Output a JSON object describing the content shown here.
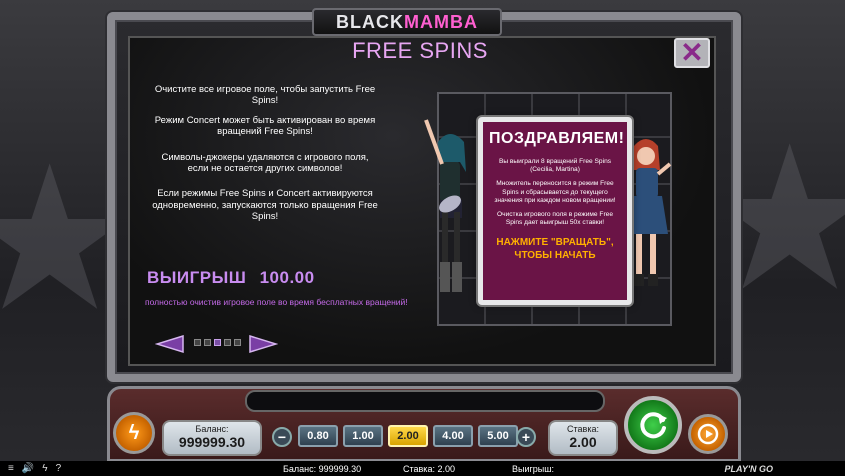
{
  "logo": {
    "prefix": "BLACK",
    "accent": "MAMBA"
  },
  "panel": {
    "title": "FREE SPINS",
    "rules": [
      "Очистите все игровое поле, чтобы запустить Free Spins!",
      "Режим Concert может быть активирован во время вращений Free Spins!",
      "Символы-джокеры удаляются с игрового поля, если не остается других символов!",
      "Если режимы Free Spins и Concert активируются одновременно, запускаются только вращения Free Spins!"
    ],
    "win_label": "ВЫИГРЫШ",
    "win_value": "100.00",
    "win_note": "полностью очистив игровое поле во время бесплатных вращений!",
    "page_count": 5,
    "active_page": 3
  },
  "popup": {
    "heading": "ПОЗДРАВЛЯЕМ!",
    "line1": "Вы выиграли 8 вращений Free Spins (Cecilia, Martina)",
    "line2": "Множитель переносится в режим Free Spins и сбрасывается до текущего значения при каждом новом вращении!",
    "line3": "Очистка игрового поля в режиме Free Spins дает выигрыш 50x ставки!",
    "cta": "НАЖМИТЕ \"ВРАЩАТЬ\", ЧТОБЫ НАЧАТЬ"
  },
  "controls": {
    "info_icon": "lightning-icon",
    "balance_label": "Баланс:",
    "balance_value": "999999.30",
    "bets": [
      "0.80",
      "1.00",
      "2.00",
      "4.00",
      "5.00"
    ],
    "selected_bet": "2.00",
    "stake_label": "Ставка:",
    "stake_value": "2.00",
    "spin_icon": "refresh-icon",
    "autoplay_icon": "autoplay-icon"
  },
  "statusbar": {
    "balance": "Баланс: 999999.30",
    "stake": "Ставка: 2.00",
    "win": "Выигрыш:",
    "logo": "PLAY'N GO",
    "icons": [
      "menu-icon",
      "sound-icon",
      "lightning-icon",
      "help-icon"
    ]
  },
  "colors": {
    "title": "#e7a6f2",
    "popup_bg": "#6a1446",
    "cta": "#ffb000",
    "win_text": "#c88cf0",
    "spin_button": "#3fcf4a",
    "selected_bet": "#ffd84a"
  }
}
